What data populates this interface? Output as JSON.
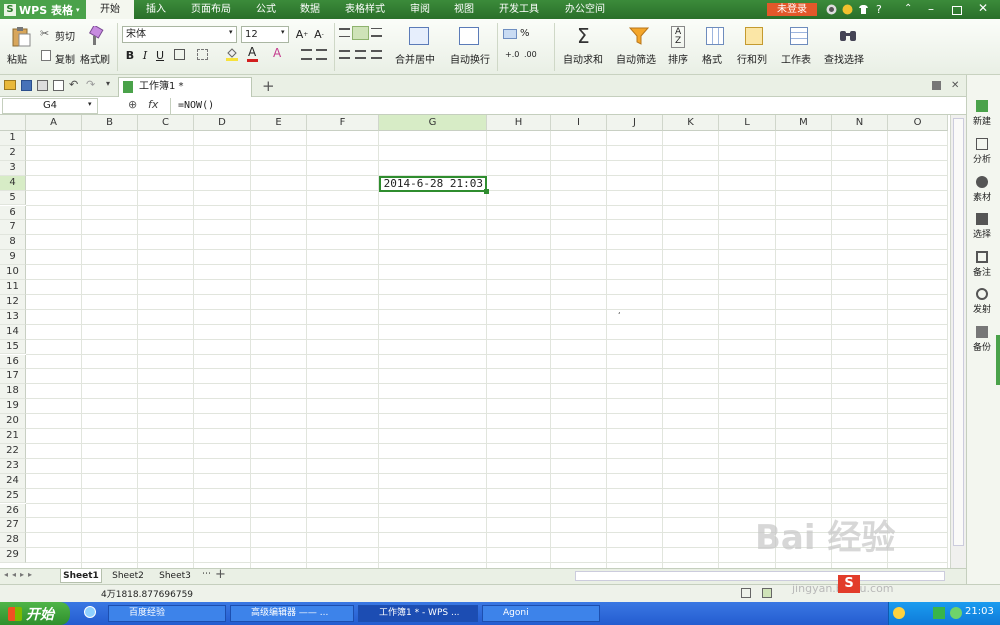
{
  "app": {
    "logo_text": "WPS 表格",
    "login_label": "未登录"
  },
  "menu": [
    "开始",
    "插入",
    "页面布局",
    "公式",
    "数据",
    "表格样式",
    "审阅",
    "视图",
    "开发工具",
    "办公空间"
  ],
  "ribbon": {
    "paste": "粘贴",
    "cut": "剪切",
    "copy": "复制",
    "format_painter": "格式刷",
    "font_name": "宋体",
    "font_size": "12",
    "merge_center": "合并居中",
    "wrap_text": "自动换行",
    "percent": "%",
    "auto_sum": "自动求和",
    "auto_filter": "自动筛选",
    "sort": "排序",
    "format": "格式",
    "row_col": "行和列",
    "worksheet": "工作表",
    "find_select": "查找选择"
  },
  "document": {
    "tab_title": "工作簿1 *"
  },
  "formula_bar": {
    "name_box": "G4",
    "fx": "fx",
    "formula": "=NOW()"
  },
  "grid": {
    "columns": [
      "A",
      "B",
      "C",
      "D",
      "E",
      "F",
      "G",
      "H",
      "I",
      "J",
      "K",
      "L",
      "M",
      "N",
      "O"
    ],
    "rows": [
      "1",
      "2",
      "3",
      "4",
      "5",
      "6",
      "7",
      "8",
      "9",
      "10",
      "11",
      "12",
      "13",
      "14",
      "15",
      "16",
      "17",
      "18",
      "19",
      "20",
      "21",
      "22",
      "23",
      "24",
      "25",
      "26",
      "27",
      "28",
      "29"
    ],
    "selected_col": "G",
    "selected_row": "4",
    "selected_value": "2014-6-28 21:03"
  },
  "side_panel": [
    "新建",
    "分析",
    "素材",
    "选择",
    "备注",
    "发射",
    "备份"
  ],
  "sheets": [
    "Sheet1",
    "Sheet2",
    "Sheet3"
  ],
  "status": {
    "text": "4万1818.877696759"
  },
  "taskbar": {
    "start": "开始",
    "items": [
      "百度经验",
      "高级编辑器 —— ...",
      "工作簿1 * - WPS ...",
      "Agoni"
    ],
    "clock": "21:03"
  },
  "watermark": {
    "text": "Bai 经验",
    "url": "jingyan.baidu.com"
  }
}
